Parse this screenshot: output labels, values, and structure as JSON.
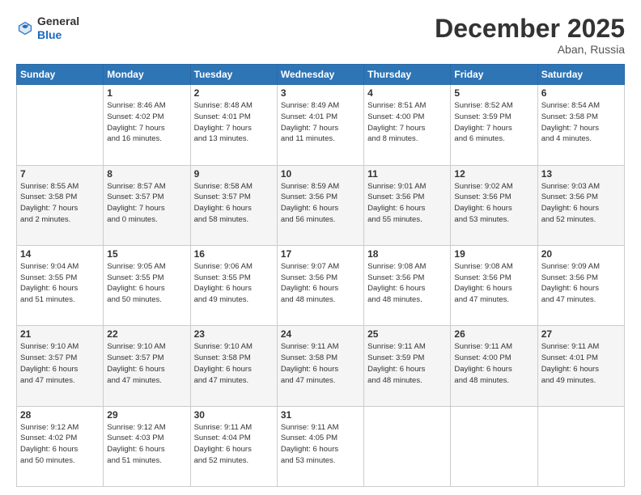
{
  "header": {
    "logo_general": "General",
    "logo_blue": "Blue",
    "month": "December 2025",
    "location": "Aban, Russia"
  },
  "days_of_week": [
    "Sunday",
    "Monday",
    "Tuesday",
    "Wednesday",
    "Thursday",
    "Friday",
    "Saturday"
  ],
  "weeks": [
    [
      {
        "day": "",
        "info": ""
      },
      {
        "day": "1",
        "info": "Sunrise: 8:46 AM\nSunset: 4:02 PM\nDaylight: 7 hours\nand 16 minutes."
      },
      {
        "day": "2",
        "info": "Sunrise: 8:48 AM\nSunset: 4:01 PM\nDaylight: 7 hours\nand 13 minutes."
      },
      {
        "day": "3",
        "info": "Sunrise: 8:49 AM\nSunset: 4:01 PM\nDaylight: 7 hours\nand 11 minutes."
      },
      {
        "day": "4",
        "info": "Sunrise: 8:51 AM\nSunset: 4:00 PM\nDaylight: 7 hours\nand 8 minutes."
      },
      {
        "day": "5",
        "info": "Sunrise: 8:52 AM\nSunset: 3:59 PM\nDaylight: 7 hours\nand 6 minutes."
      },
      {
        "day": "6",
        "info": "Sunrise: 8:54 AM\nSunset: 3:58 PM\nDaylight: 7 hours\nand 4 minutes."
      }
    ],
    [
      {
        "day": "7",
        "info": "Sunrise: 8:55 AM\nSunset: 3:58 PM\nDaylight: 7 hours\nand 2 minutes."
      },
      {
        "day": "8",
        "info": "Sunrise: 8:57 AM\nSunset: 3:57 PM\nDaylight: 7 hours\nand 0 minutes."
      },
      {
        "day": "9",
        "info": "Sunrise: 8:58 AM\nSunset: 3:57 PM\nDaylight: 6 hours\nand 58 minutes."
      },
      {
        "day": "10",
        "info": "Sunrise: 8:59 AM\nSunset: 3:56 PM\nDaylight: 6 hours\nand 56 minutes."
      },
      {
        "day": "11",
        "info": "Sunrise: 9:01 AM\nSunset: 3:56 PM\nDaylight: 6 hours\nand 55 minutes."
      },
      {
        "day": "12",
        "info": "Sunrise: 9:02 AM\nSunset: 3:56 PM\nDaylight: 6 hours\nand 53 minutes."
      },
      {
        "day": "13",
        "info": "Sunrise: 9:03 AM\nSunset: 3:56 PM\nDaylight: 6 hours\nand 52 minutes."
      }
    ],
    [
      {
        "day": "14",
        "info": "Sunrise: 9:04 AM\nSunset: 3:55 PM\nDaylight: 6 hours\nand 51 minutes."
      },
      {
        "day": "15",
        "info": "Sunrise: 9:05 AM\nSunset: 3:55 PM\nDaylight: 6 hours\nand 50 minutes."
      },
      {
        "day": "16",
        "info": "Sunrise: 9:06 AM\nSunset: 3:55 PM\nDaylight: 6 hours\nand 49 minutes."
      },
      {
        "day": "17",
        "info": "Sunrise: 9:07 AM\nSunset: 3:56 PM\nDaylight: 6 hours\nand 48 minutes."
      },
      {
        "day": "18",
        "info": "Sunrise: 9:08 AM\nSunset: 3:56 PM\nDaylight: 6 hours\nand 48 minutes."
      },
      {
        "day": "19",
        "info": "Sunrise: 9:08 AM\nSunset: 3:56 PM\nDaylight: 6 hours\nand 47 minutes."
      },
      {
        "day": "20",
        "info": "Sunrise: 9:09 AM\nSunset: 3:56 PM\nDaylight: 6 hours\nand 47 minutes."
      }
    ],
    [
      {
        "day": "21",
        "info": "Sunrise: 9:10 AM\nSunset: 3:57 PM\nDaylight: 6 hours\nand 47 minutes."
      },
      {
        "day": "22",
        "info": "Sunrise: 9:10 AM\nSunset: 3:57 PM\nDaylight: 6 hours\nand 47 minutes."
      },
      {
        "day": "23",
        "info": "Sunrise: 9:10 AM\nSunset: 3:58 PM\nDaylight: 6 hours\nand 47 minutes."
      },
      {
        "day": "24",
        "info": "Sunrise: 9:11 AM\nSunset: 3:58 PM\nDaylight: 6 hours\nand 47 minutes."
      },
      {
        "day": "25",
        "info": "Sunrise: 9:11 AM\nSunset: 3:59 PM\nDaylight: 6 hours\nand 48 minutes."
      },
      {
        "day": "26",
        "info": "Sunrise: 9:11 AM\nSunset: 4:00 PM\nDaylight: 6 hours\nand 48 minutes."
      },
      {
        "day": "27",
        "info": "Sunrise: 9:11 AM\nSunset: 4:01 PM\nDaylight: 6 hours\nand 49 minutes."
      }
    ],
    [
      {
        "day": "28",
        "info": "Sunrise: 9:12 AM\nSunset: 4:02 PM\nDaylight: 6 hours\nand 50 minutes."
      },
      {
        "day": "29",
        "info": "Sunrise: 9:12 AM\nSunset: 4:03 PM\nDaylight: 6 hours\nand 51 minutes."
      },
      {
        "day": "30",
        "info": "Sunrise: 9:11 AM\nSunset: 4:04 PM\nDaylight: 6 hours\nand 52 minutes."
      },
      {
        "day": "31",
        "info": "Sunrise: 9:11 AM\nSunset: 4:05 PM\nDaylight: 6 hours\nand 53 minutes."
      },
      {
        "day": "",
        "info": ""
      },
      {
        "day": "",
        "info": ""
      },
      {
        "day": "",
        "info": ""
      }
    ]
  ]
}
